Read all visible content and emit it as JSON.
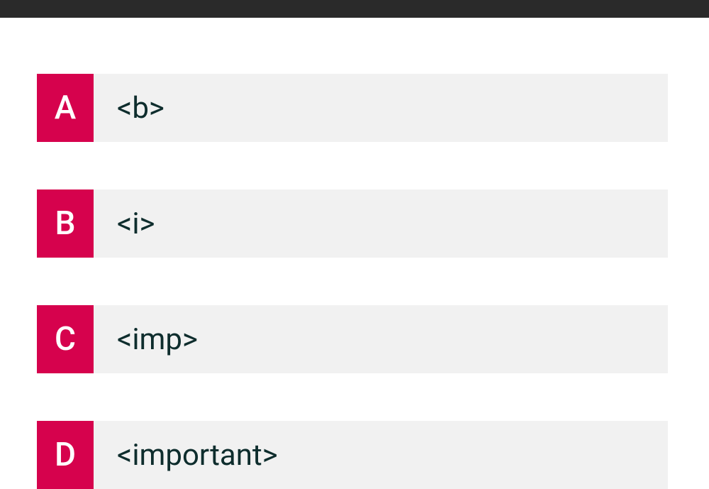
{
  "options": [
    {
      "letter": "A",
      "text": "<b>"
    },
    {
      "letter": "B",
      "text": "<i>"
    },
    {
      "letter": "C",
      "text": "<imp>"
    },
    {
      "letter": "D",
      "text": "<important>"
    }
  ]
}
